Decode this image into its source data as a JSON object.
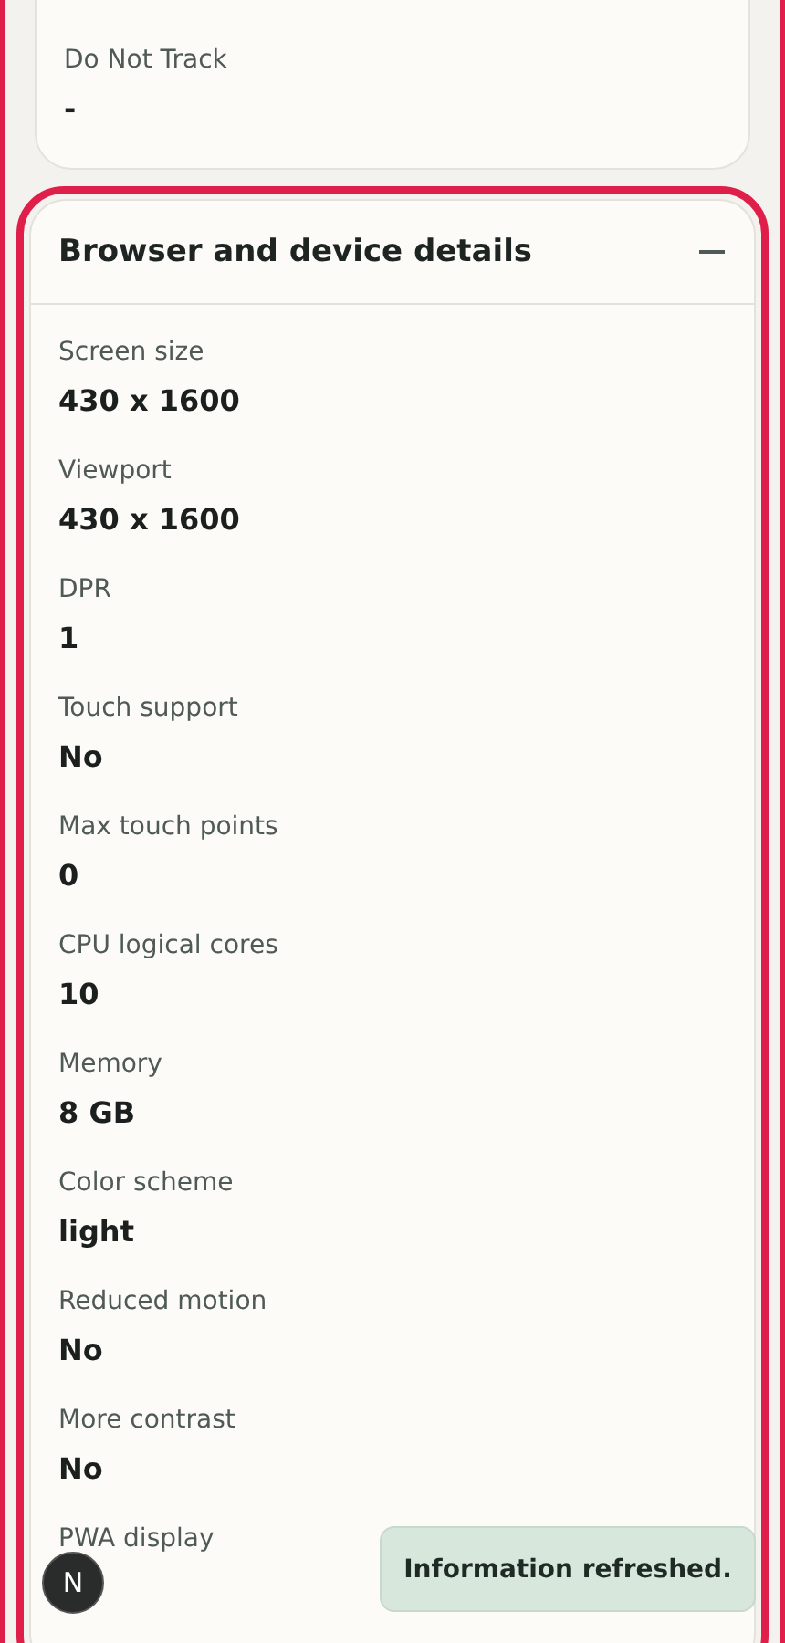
{
  "top_card": {
    "items": [
      {
        "label": "Do Not Track",
        "value": "-"
      }
    ]
  },
  "details": {
    "title": "Browser and device details",
    "expanded": true,
    "items": [
      {
        "label": "Screen size",
        "value": "430 x 1600"
      },
      {
        "label": "Viewport",
        "value": "430 x 1600"
      },
      {
        "label": "DPR",
        "value": "1"
      },
      {
        "label": "Touch support",
        "value": "No"
      },
      {
        "label": "Max touch points",
        "value": "0"
      },
      {
        "label": "CPU logical cores",
        "value": "10"
      },
      {
        "label": "Memory",
        "value": "8 GB"
      },
      {
        "label": "Color scheme",
        "value": "light"
      },
      {
        "label": "Reduced motion",
        "value": "No"
      },
      {
        "label": "More contrast",
        "value": "No"
      },
      {
        "label": "PWA display"
      }
    ]
  },
  "badge": {
    "letter": "N"
  },
  "toast": {
    "message": "Information refreshed."
  }
}
